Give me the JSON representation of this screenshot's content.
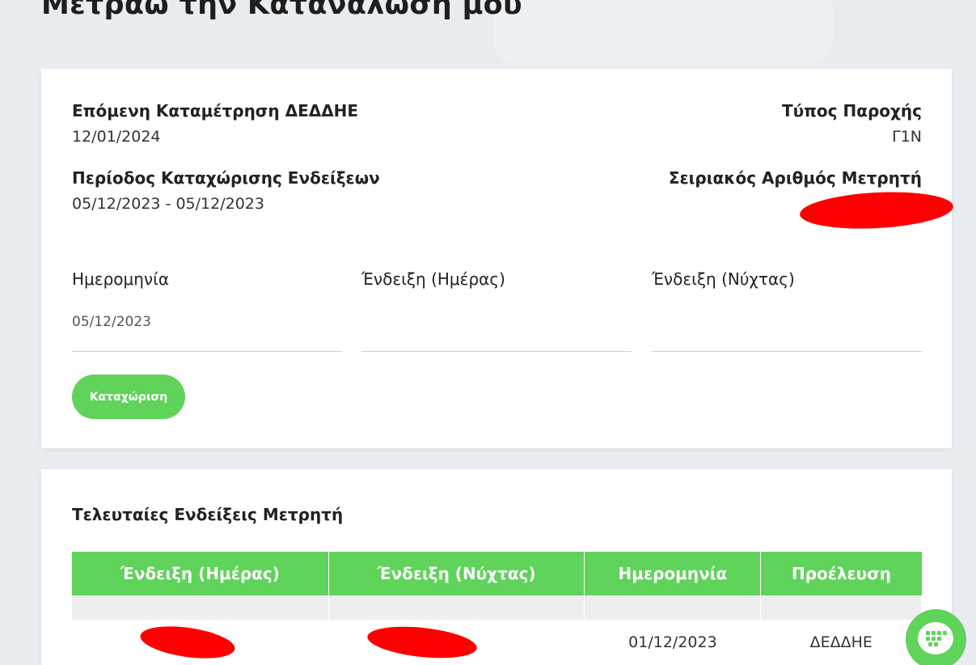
{
  "page": {
    "title": "Μετράω την Κατανάλωσή μου"
  },
  "info": {
    "next_reading_label": "Επόμενη Καταμέτρηση ΔΕΔΔΗΕ",
    "next_reading_value": "12/01/2024",
    "supply_type_label": "Τύπος Παροχής",
    "supply_type_value": "Γ1Ν",
    "period_label": "Περίοδος Καταχώρισης Ενδείξεων",
    "period_value": "05/12/2023 - 05/12/2023",
    "serial_label": "Σειριακός Αριθμός Μετρητή"
  },
  "form": {
    "date_label": "Ημερομηνία",
    "date_value": "05/12/2023",
    "day_label": "Ένδειξη (Ημέρας)",
    "night_label": "Ένδειξη (Νύχτας)",
    "submit_label": "Καταχώριση"
  },
  "readings": {
    "title": "Τελευταίες Ενδείξεις Μετρητή",
    "headers": [
      "Ένδειξη (Ημέρας)",
      "Ένδειξη (Νύχτας)",
      "Ημερομηνία",
      "Προέλευση"
    ],
    "rows": [
      {
        "date": "01/12/2023",
        "source": "ΔΕΔΔΗΕ"
      }
    ]
  },
  "colors": {
    "accent": "#5fd35a",
    "redaction": "#ff0000"
  },
  "icons": {
    "chat": "chat-bubble-icon"
  }
}
